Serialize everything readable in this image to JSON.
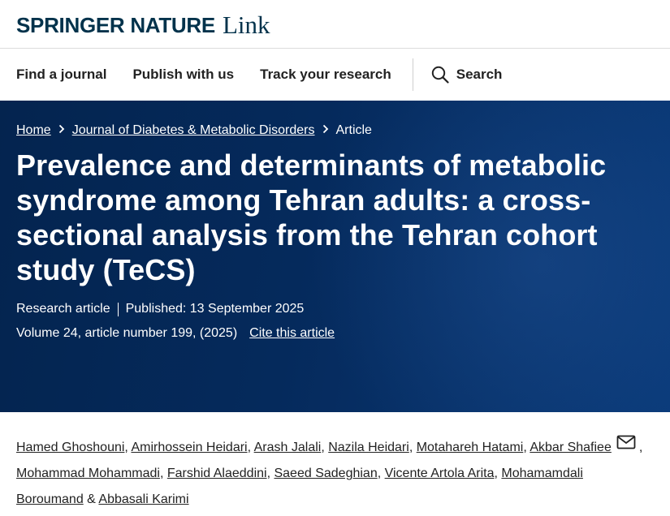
{
  "logo": {
    "brand": "SPRINGER NATURE",
    "product": "Link"
  },
  "nav": {
    "items": [
      "Find a journal",
      "Publish with us",
      "Track your research"
    ],
    "search_label": "Search"
  },
  "breadcrumb": {
    "home": "Home",
    "journal": "Journal of Diabetes & Metabolic Disorders",
    "current": "Article"
  },
  "article": {
    "title": "Prevalence and determinants of metabolic syndrome among Tehran adults: a cross-sectional analysis from the Tehran cohort study (TeCS)",
    "type": "Research article",
    "published": "Published: 13 September 2025",
    "volume": "Volume 24, article number 199, (2025)",
    "cite_label": "Cite this article"
  },
  "authors": {
    "list": [
      "Hamed Ghoshouni",
      "Amirhossein Heidari",
      "Arash Jalali",
      "Nazila Heidari",
      "Motahareh Hatami",
      "Akbar Shafiee",
      "Mohammad Mohammadi",
      "Farshid Alaeddini",
      "Saeed Sadeghian",
      "Vicente Artola Arita",
      "Mohamamdali Boroumand",
      "Abbasali Karimi"
    ],
    "separator": ", ",
    "final_separator": " & "
  },
  "colors": {
    "hero_bg": "#052a5c",
    "brand": "#01324b"
  },
  "icons": {
    "search": "search-icon",
    "breadcrumb_separator": "chevron-right-icon",
    "email": "mail-icon"
  }
}
